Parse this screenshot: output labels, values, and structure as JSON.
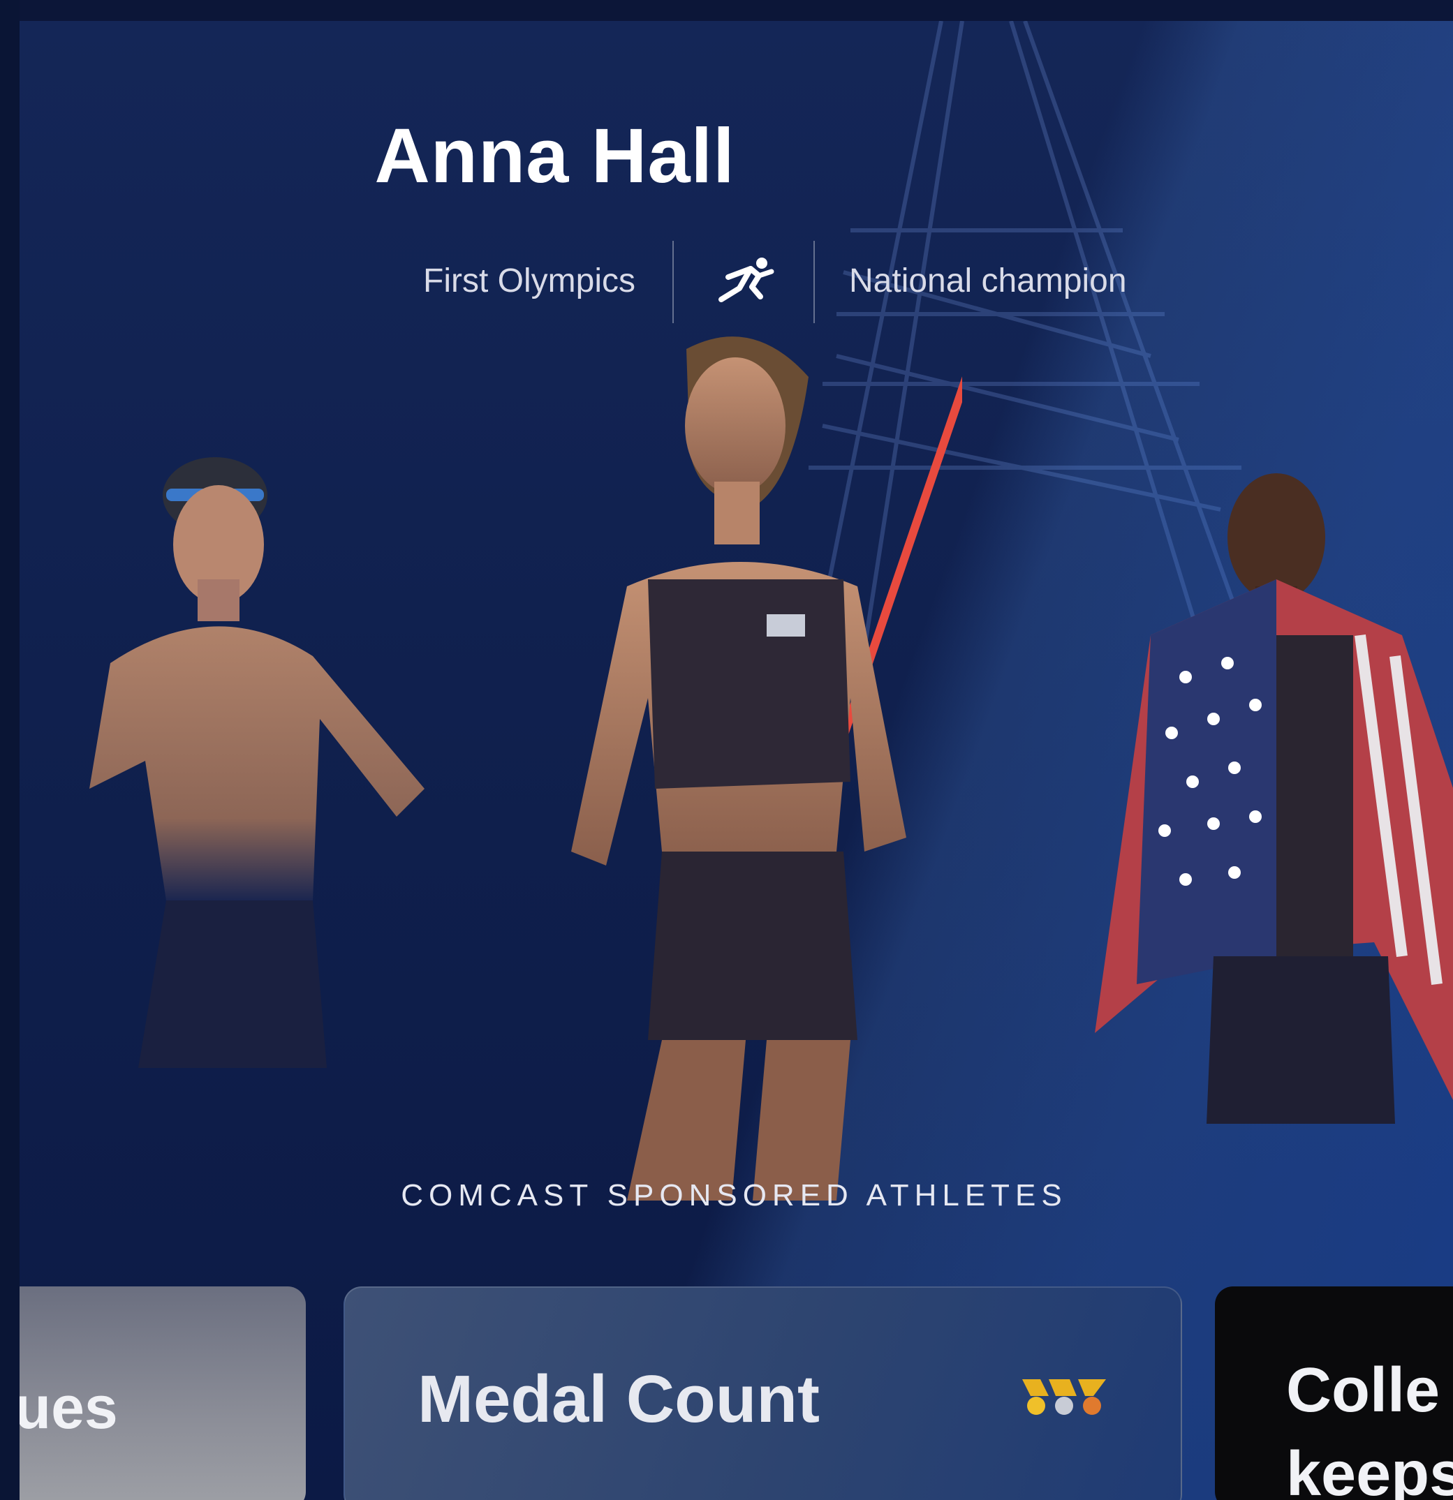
{
  "hero": {
    "athlete_name": "Anna Hall",
    "first_stat": "First Olympics",
    "sport_icon": "runner-icon",
    "second_stat": "National champion",
    "section_label": "COMCAST SPONSORED ATHLETES"
  },
  "athletes": [
    {
      "role": "swimmer"
    },
    {
      "role": "heptathlete-javelin"
    },
    {
      "role": "sprinter-with-flag"
    }
  ],
  "cards": {
    "left_partial": "nues",
    "middle_title": "Medal Count",
    "middle_icon": "medals-icon",
    "right_partial_line1": "Colle",
    "right_partial_line2": "keeps"
  },
  "colors": {
    "background": "#0f1f4c",
    "accent": "#1f3b74",
    "text": "#ffffff"
  }
}
